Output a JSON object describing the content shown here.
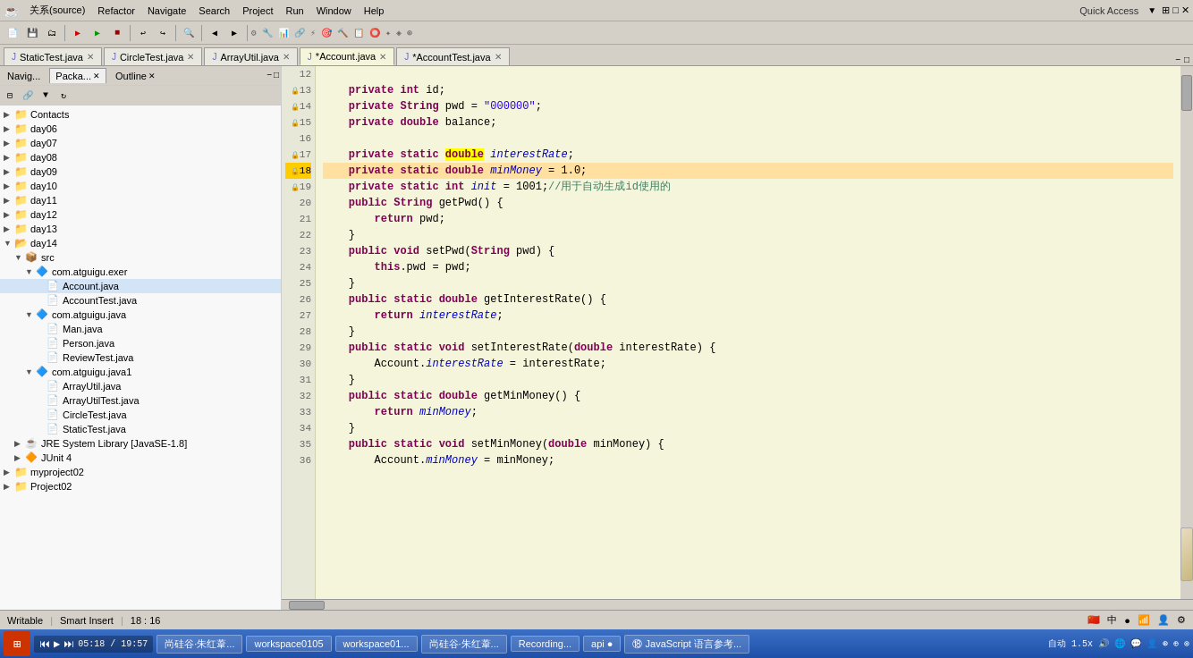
{
  "menubar": {
    "items": [
      "关系(source)",
      "Refactor",
      "Navigate",
      "Search",
      "Project",
      "Run",
      "Window",
      "Help"
    ]
  },
  "toolbar": {
    "quick_access_label": "Quick Access"
  },
  "tabs": [
    {
      "id": "static-test",
      "label": "StaticTest.java",
      "icon": "J",
      "active": false,
      "modified": false
    },
    {
      "id": "circle-test",
      "label": "CircleTest.java",
      "icon": "J",
      "active": false,
      "modified": false
    },
    {
      "id": "array-util",
      "label": "ArrayUtil.java",
      "icon": "J",
      "active": false,
      "modified": false
    },
    {
      "id": "account",
      "label": "*Account.java",
      "icon": "J",
      "active": true,
      "modified": true
    },
    {
      "id": "account-test",
      "label": "*AccountTest.java",
      "icon": "J",
      "active": false,
      "modified": true
    }
  ],
  "panel": {
    "tabs": [
      {
        "id": "navigator",
        "label": "Navig...",
        "active": false
      },
      {
        "id": "package",
        "label": "Packa...",
        "active": true
      },
      {
        "id": "outline",
        "label": "Outline",
        "active": false
      }
    ]
  },
  "tree": {
    "items": [
      {
        "level": 0,
        "label": "Contacts",
        "type": "folder",
        "expanded": true,
        "arrow": "▶"
      },
      {
        "level": 0,
        "label": "day06",
        "type": "folder",
        "expanded": false,
        "arrow": "▶"
      },
      {
        "level": 0,
        "label": "day07",
        "type": "folder",
        "expanded": false,
        "arrow": "▶"
      },
      {
        "level": 0,
        "label": "day08",
        "type": "folder",
        "expanded": false,
        "arrow": "▶"
      },
      {
        "level": 0,
        "label": "day09",
        "type": "folder",
        "expanded": false,
        "arrow": "▶"
      },
      {
        "level": 0,
        "label": "day10",
        "type": "folder",
        "expanded": false,
        "arrow": "▶"
      },
      {
        "level": 0,
        "label": "day11",
        "type": "folder",
        "expanded": false,
        "arrow": "▶"
      },
      {
        "level": 0,
        "label": "day12",
        "type": "folder",
        "expanded": false,
        "arrow": "▶"
      },
      {
        "level": 0,
        "label": "day13",
        "type": "folder",
        "expanded": false,
        "arrow": "▶"
      },
      {
        "level": 0,
        "label": "day14",
        "type": "folder",
        "expanded": true,
        "arrow": "▼"
      },
      {
        "level": 1,
        "label": "src",
        "type": "src",
        "expanded": true,
        "arrow": "▼"
      },
      {
        "level": 2,
        "label": "com.atguigu.exer",
        "type": "package",
        "expanded": true,
        "arrow": "▼"
      },
      {
        "level": 3,
        "label": "Account.java",
        "type": "java",
        "expanded": false,
        "arrow": ""
      },
      {
        "level": 3,
        "label": "AccountTest.java",
        "type": "java",
        "expanded": false,
        "arrow": ""
      },
      {
        "level": 2,
        "label": "com.atguigu.java",
        "type": "package",
        "expanded": true,
        "arrow": "▼"
      },
      {
        "level": 3,
        "label": "Man.java",
        "type": "java",
        "expanded": false,
        "arrow": ""
      },
      {
        "level": 3,
        "label": "Person.java",
        "type": "java",
        "expanded": false,
        "arrow": ""
      },
      {
        "level": 3,
        "label": "ReviewTest.java",
        "type": "java",
        "expanded": false,
        "arrow": ""
      },
      {
        "level": 2,
        "label": "com.atguigu.java1",
        "type": "package",
        "expanded": true,
        "arrow": "▼"
      },
      {
        "level": 3,
        "label": "ArrayUtil.java",
        "type": "java",
        "expanded": false,
        "arrow": ""
      },
      {
        "level": 3,
        "label": "ArrayUtilTest.java",
        "type": "java",
        "expanded": false,
        "arrow": ""
      },
      {
        "level": 3,
        "label": "CircleTest.java",
        "type": "java",
        "expanded": false,
        "arrow": ""
      },
      {
        "level": 3,
        "label": "StaticTest.java",
        "type": "java",
        "expanded": false,
        "arrow": ""
      },
      {
        "level": 1,
        "label": "JRE System Library [JavaSE-1.8]",
        "type": "jre",
        "expanded": false,
        "arrow": "▶"
      },
      {
        "level": 1,
        "label": "JUnit 4",
        "type": "junit",
        "expanded": false,
        "arrow": "▶"
      },
      {
        "level": 0,
        "label": "myproject02",
        "type": "project",
        "expanded": false,
        "arrow": "▶"
      },
      {
        "level": 0,
        "label": "Project02",
        "type": "project",
        "expanded": false,
        "arrow": "▶"
      }
    ]
  },
  "code": {
    "lines": [
      {
        "num": 12,
        "content": "",
        "highlight": false
      },
      {
        "num": 13,
        "tokens": [
          {
            "t": "kw",
            "v": "private"
          },
          {
            "t": "sp",
            "v": " "
          },
          {
            "t": "kw",
            "v": "int"
          },
          {
            "t": "sp",
            "v": " id;"
          }
        ],
        "highlight": false
      },
      {
        "num": 14,
        "tokens": [
          {
            "t": "kw",
            "v": "private"
          },
          {
            "t": "sp",
            "v": " "
          },
          {
            "t": "kw",
            "v": "String"
          },
          {
            "t": "sp",
            "v": " pwd = "
          },
          {
            "t": "str",
            "v": "\"000000\""
          },
          {
            "t": "sp",
            "v": ";"
          }
        ],
        "highlight": false
      },
      {
        "num": 15,
        "tokens": [
          {
            "t": "kw",
            "v": "private"
          },
          {
            "t": "sp",
            "v": " "
          },
          {
            "t": "kw",
            "v": "double"
          },
          {
            "t": "sp",
            "v": " balance;"
          }
        ],
        "highlight": false
      },
      {
        "num": 16,
        "content": "",
        "highlight": false
      },
      {
        "num": 17,
        "tokens": [
          {
            "t": "kw",
            "v": "private"
          },
          {
            "t": "sp",
            "v": " "
          },
          {
            "t": "kw",
            "v": "static"
          },
          {
            "t": "sp",
            "v": " "
          },
          {
            "t": "kw-hl",
            "v": "double"
          },
          {
            "t": "sp",
            "v": " "
          },
          {
            "t": "italic",
            "v": "interestRate"
          },
          {
            "t": "sp",
            "v": ";"
          }
        ],
        "highlight": false
      },
      {
        "num": 18,
        "tokens": [
          {
            "t": "kw",
            "v": "private"
          },
          {
            "t": "sp",
            "v": " "
          },
          {
            "t": "kw",
            "v": "static"
          },
          {
            "t": "sp",
            "v": " "
          },
          {
            "t": "kw",
            "v": "double"
          },
          {
            "t": "sp",
            "v": " "
          },
          {
            "t": "italic",
            "v": "minMoney"
          },
          {
            "t": "sp",
            "v": " = 1.0;"
          }
        ],
        "highlight": true
      },
      {
        "num": 19,
        "tokens": [
          {
            "t": "kw",
            "v": "private"
          },
          {
            "t": "sp",
            "v": " "
          },
          {
            "t": "kw",
            "v": "static"
          },
          {
            "t": "sp",
            "v": " "
          },
          {
            "t": "kw",
            "v": "int"
          },
          {
            "t": "sp",
            "v": " "
          },
          {
            "t": "italic",
            "v": "init"
          },
          {
            "t": "sp",
            "v": " = 1001;"
          },
          {
            "t": "comment",
            "v": "//用于自动生成id使用的"
          }
        ],
        "highlight": false
      },
      {
        "num": 20,
        "tokens": [
          {
            "t": "kw",
            "v": "public"
          },
          {
            "t": "sp",
            "v": " "
          },
          {
            "t": "kw",
            "v": "String"
          },
          {
            "t": "sp",
            "v": " getPwd() {"
          }
        ],
        "highlight": false
      },
      {
        "num": 21,
        "tokens": [
          {
            "t": "sp",
            "v": "        "
          },
          {
            "t": "kw",
            "v": "return"
          },
          {
            "t": "sp",
            "v": " pwd;"
          }
        ],
        "highlight": false
      },
      {
        "num": 22,
        "content": "    }",
        "highlight": false
      },
      {
        "num": 23,
        "tokens": [
          {
            "t": "kw",
            "v": "public"
          },
          {
            "t": "sp",
            "v": " "
          },
          {
            "t": "kw",
            "v": "void"
          },
          {
            "t": "sp",
            "v": " setPwd("
          },
          {
            "t": "kw",
            "v": "String"
          },
          {
            "t": "sp",
            "v": " pwd) {"
          }
        ],
        "highlight": false
      },
      {
        "num": 24,
        "tokens": [
          {
            "t": "sp",
            "v": "        "
          },
          {
            "t": "kw",
            "v": "this"
          },
          {
            "t": "sp",
            "v": ".pwd = pwd;"
          }
        ],
        "highlight": false
      },
      {
        "num": 25,
        "content": "    }",
        "highlight": false
      },
      {
        "num": 26,
        "tokens": [
          {
            "t": "kw",
            "v": "public"
          },
          {
            "t": "sp",
            "v": " "
          },
          {
            "t": "kw",
            "v": "static"
          },
          {
            "t": "sp",
            "v": " "
          },
          {
            "t": "kw",
            "v": "double"
          },
          {
            "t": "sp",
            "v": " getInterestRate() {"
          }
        ],
        "highlight": false
      },
      {
        "num": 27,
        "tokens": [
          {
            "t": "sp",
            "v": "        "
          },
          {
            "t": "kw",
            "v": "return"
          },
          {
            "t": "sp",
            "v": " "
          },
          {
            "t": "italic",
            "v": "interestRate"
          },
          {
            "t": "sp",
            "v": ";"
          }
        ],
        "highlight": false
      },
      {
        "num": 28,
        "content": "    }",
        "highlight": false
      },
      {
        "num": 29,
        "tokens": [
          {
            "t": "kw",
            "v": "public"
          },
          {
            "t": "sp",
            "v": " "
          },
          {
            "t": "kw",
            "v": "static"
          },
          {
            "t": "sp",
            "v": " "
          },
          {
            "t": "kw",
            "v": "void"
          },
          {
            "t": "sp",
            "v": " setInterestRate("
          },
          {
            "t": "kw",
            "v": "double"
          },
          {
            "t": "sp",
            "v": " interestRate) {"
          }
        ],
        "highlight": false
      },
      {
        "num": 30,
        "tokens": [
          {
            "t": "sp",
            "v": "        "
          },
          {
            "t": "sp",
            "v": "Account."
          },
          {
            "t": "italic",
            "v": "interestRate"
          },
          {
            "t": "sp",
            "v": " = interestRate;"
          }
        ],
        "highlight": false
      },
      {
        "num": 31,
        "content": "    }",
        "highlight": false
      },
      {
        "num": 32,
        "tokens": [
          {
            "t": "kw",
            "v": "public"
          },
          {
            "t": "sp",
            "v": " "
          },
          {
            "t": "kw",
            "v": "static"
          },
          {
            "t": "sp",
            "v": " "
          },
          {
            "t": "kw",
            "v": "double"
          },
          {
            "t": "sp",
            "v": " getMinMoney() {"
          }
        ],
        "highlight": false
      },
      {
        "num": 33,
        "tokens": [
          {
            "t": "sp",
            "v": "        "
          },
          {
            "t": "kw",
            "v": "return"
          },
          {
            "t": "sp",
            "v": " "
          },
          {
            "t": "italic",
            "v": "minMoney"
          },
          {
            "t": "sp",
            "v": ";"
          }
        ],
        "highlight": false
      },
      {
        "num": 34,
        "content": "    }",
        "highlight": false
      },
      {
        "num": 35,
        "tokens": [
          {
            "t": "kw",
            "v": "public"
          },
          {
            "t": "sp",
            "v": " "
          },
          {
            "t": "kw",
            "v": "static"
          },
          {
            "t": "sp",
            "v": " "
          },
          {
            "t": "kw",
            "v": "void"
          },
          {
            "t": "sp",
            "v": " setMinMoney("
          },
          {
            "t": "kw",
            "v": "double"
          },
          {
            "t": "sp",
            "v": " minMoney) {"
          }
        ],
        "highlight": false
      },
      {
        "num": 36,
        "tokens": [
          {
            "t": "sp",
            "v": "        "
          },
          {
            "t": "sp",
            "v": "Account."
          },
          {
            "t": "italic",
            "v": "minMoney"
          },
          {
            "t": "sp",
            "v": " = minMoney;"
          }
        ],
        "highlight": false
      }
    ]
  },
  "status": {
    "writable": "Writable",
    "smart_insert": "Smart Insert",
    "position": "18 : 16"
  },
  "taskbar": {
    "time": "05:18 / 19:57",
    "speed": "1.5x",
    "lang": "自动",
    "buttons": [
      {
        "id": "atguigu1",
        "label": "尚硅谷·朱红葦...",
        "active": false
      },
      {
        "id": "workspace0105",
        "label": "workspace0105",
        "active": false
      },
      {
        "id": "workspace01",
        "label": "workspace01...",
        "active": false
      },
      {
        "id": "atguigu2",
        "label": "尚硅谷·朱红葦...",
        "active": false
      },
      {
        "id": "recording",
        "label": "Recording...",
        "active": false
      },
      {
        "id": "api",
        "label": "api ●",
        "active": false
      },
      {
        "id": "javascript",
        "label": "⑱ JavaScript 语言参考...",
        "active": false
      }
    ]
  }
}
